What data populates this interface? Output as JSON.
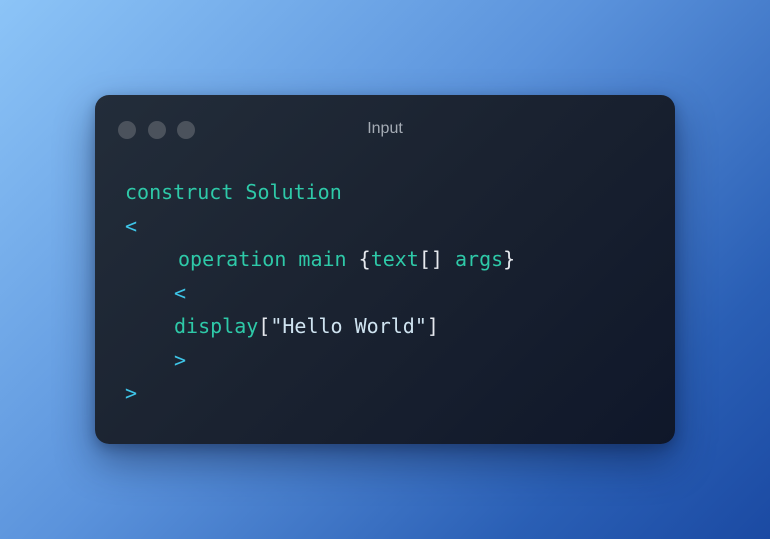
{
  "window": {
    "title": "Input"
  },
  "code": {
    "line1": {
      "kw1": "construct",
      "name": "Solution"
    },
    "line2": {
      "brace": "<"
    },
    "line3": {
      "kw1": "operation",
      "name": "main",
      "open": "{",
      "type": "text",
      "arr": "[]",
      "arg": "args",
      "close": "}"
    },
    "line4": {
      "brace": "<"
    },
    "line5": {
      "fn": "display",
      "open": "[",
      "str": "\"Hello World\"",
      "close": "]"
    },
    "line6": {
      "brace": ">"
    },
    "line7": {
      "brace": ">"
    }
  },
  "colors": {
    "keyword": "#2ec9a8",
    "bracket": "#3ec5e8",
    "plain": "#e6e9ee",
    "dot": "#4b525c"
  }
}
